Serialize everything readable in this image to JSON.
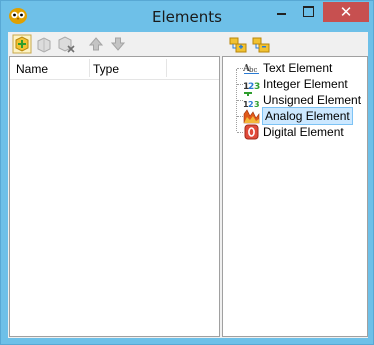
{
  "window": {
    "title": "Elements",
    "close_glyph": "✕"
  },
  "toolbar": {
    "buttons": [
      {
        "icon": "add-element-icon",
        "enabled": true
      },
      {
        "icon": "edit-element-icon",
        "enabled": false
      },
      {
        "icon": "delete-element-icon",
        "enabled": false
      },
      {
        "icon": "move-up-icon",
        "enabled": false
      },
      {
        "icon": "move-down-icon",
        "enabled": false
      }
    ]
  },
  "list": {
    "columns": [
      "Name",
      "Type"
    ]
  },
  "tree": {
    "toolbar": [
      {
        "icon": "expand-all-icon"
      },
      {
        "icon": "collapse-all-icon"
      }
    ],
    "items": [
      {
        "label": "Text Element",
        "icon": "text-element-icon"
      },
      {
        "label": "Integer Element",
        "icon": "integer-element-icon"
      },
      {
        "label": "Unsigned Element",
        "icon": "unsigned-element-icon"
      },
      {
        "label": "Analog Element",
        "icon": "analog-element-icon",
        "selected": true
      },
      {
        "label": "Digital Element",
        "icon": "digital-element-icon"
      }
    ]
  },
  "colors": {
    "window_frame": "#6ec0e8",
    "close_button": "#c75050",
    "selection": "#cce8ff"
  }
}
